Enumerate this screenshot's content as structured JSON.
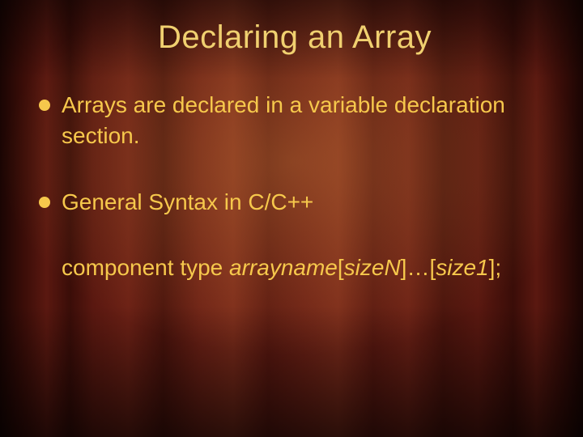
{
  "title": "Declaring an Array",
  "bullets": [
    "Arrays are declared in a variable declaration section.",
    "General Syntax in C/C++"
  ],
  "syntax": {
    "prefix": "component type ",
    "name": "arrayname",
    "br1o": "[",
    "sizeN": "sizeN",
    "br1c": "]…[",
    "size1": "size1",
    "br2c": "];"
  },
  "colors": {
    "text": "#f6c84c",
    "title": "#f0d070"
  }
}
